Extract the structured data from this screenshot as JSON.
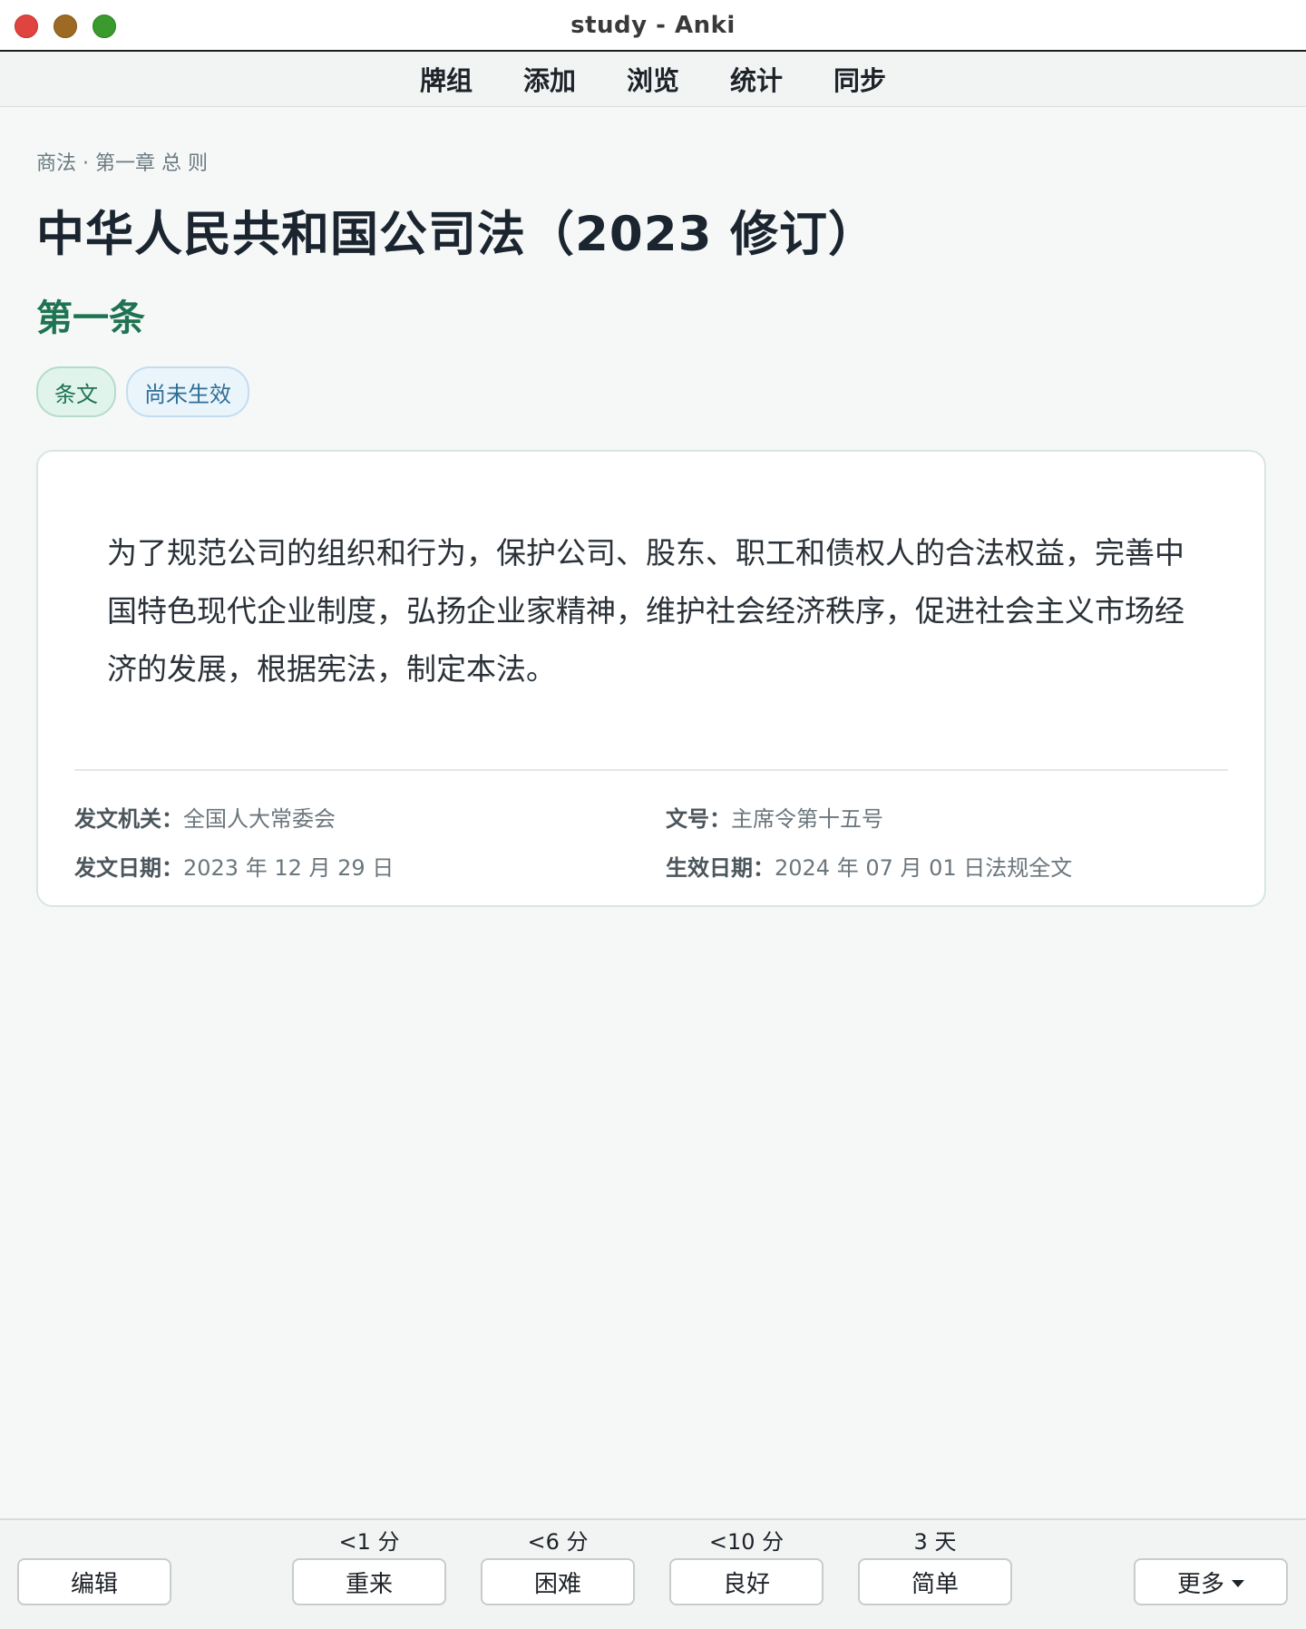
{
  "window": {
    "title": "study - Anki"
  },
  "toolbar": {
    "items": [
      "牌组",
      "添加",
      "浏览",
      "统计",
      "同步"
    ]
  },
  "card": {
    "breadcrumb": "商法 · 第一章 总 则",
    "law_title": "中华人民共和国公司法（2023 修订）",
    "article": "第一条",
    "tags": [
      "条文",
      "尚未生效"
    ],
    "body": "为了规范公司的组织和行为，保护公司、股东、职工和债权人的合法权益，完善中国特色现代企业制度，弘扬企业家精神，维护社会经济秩序，促进社会主义市场经济的发展，根据宪法，制定本法。",
    "meta": {
      "issuer_label": "发文机关：",
      "issuer": "全国人大常委会",
      "number_label": "文号：",
      "number": "主席令第十五号",
      "issue_date_label": "发文日期：",
      "issue_date": "2023 年 12 月 29 日",
      "effective_date_label": "生效日期：",
      "effective_date": "2024 年 07 月 01 日法规全文"
    }
  },
  "bottom": {
    "edit_label": "编辑",
    "answers": [
      {
        "interval": "<1 分",
        "label": "重来"
      },
      {
        "interval": "<6 分",
        "label": "困难"
      },
      {
        "interval": "<10 分",
        "label": "良好"
      },
      {
        "interval": "3 天",
        "label": "简单"
      }
    ],
    "more_label": "更多"
  },
  "colors": {
    "accent_green": "#1f7352",
    "tag_blue": "#2e6f96",
    "close": "#e0443e",
    "minimize": "#9d6a24",
    "maximize": "#3a9a2d"
  }
}
